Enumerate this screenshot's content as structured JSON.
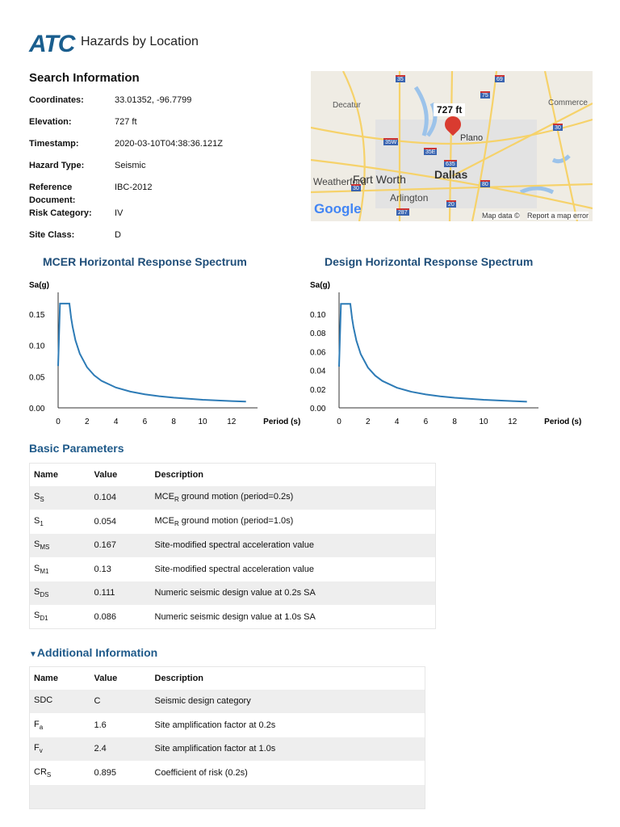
{
  "header": {
    "logo": "ATC",
    "title": "Hazards by Location"
  },
  "search": {
    "title": "Search Information",
    "fields": [
      {
        "label": "Coordinates:",
        "value": "33.01352, -96.7799"
      },
      {
        "label": "Elevation:",
        "value": "727 ft"
      },
      {
        "label": "Timestamp:",
        "value": "2020-03-10T04:38:36.121Z"
      },
      {
        "label": "Hazard Type:",
        "value": "Seismic"
      },
      {
        "label": "Reference Document:",
        "value": "IBC-2012"
      },
      {
        "label": "Risk Category:",
        "value": "IV"
      },
      {
        "label": "Site Class:",
        "value": "D"
      }
    ]
  },
  "map": {
    "marker_label": "727 ft",
    "places": [
      "Decatur",
      "Commerce",
      "Plano",
      "Fort Worth",
      "Dallas",
      "Arlington",
      "Weatherford"
    ],
    "shields": [
      "35",
      "69",
      "75",
      "35W",
      "35E",
      "635",
      "30",
      "80",
      "20",
      "287",
      "30"
    ],
    "google": "Google",
    "attribution": "Map data ©",
    "report": "Report a map error",
    "accent": "#d93b30"
  },
  "chart_data": [
    {
      "type": "line",
      "title": "MCER Horizontal Response Spectrum",
      "ylabel": "Sa(g)",
      "xlabel": "Period (s)",
      "xlim": [
        0,
        14
      ],
      "ylim": [
        0,
        0.19
      ],
      "xticks": [
        "0",
        "2",
        "4",
        "6",
        "8",
        "10",
        "12"
      ],
      "yticks": [
        "0.00",
        "0.05",
        "0.10",
        "0.15"
      ],
      "ytick_values": [
        0,
        0.05,
        0.1,
        0.15
      ],
      "x": [
        0,
        0.13,
        0.78,
        0.9,
        1,
        1.2,
        1.5,
        2,
        2.5,
        3,
        4,
        5,
        6,
        7,
        8,
        10,
        12,
        13
      ],
      "y": [
        0.067,
        0.167,
        0.167,
        0.144,
        0.13,
        0.108,
        0.0867,
        0.065,
        0.052,
        0.0433,
        0.0325,
        0.026,
        0.0217,
        0.0186,
        0.0163,
        0.013,
        0.0108,
        0.01
      ],
      "color": "#2d7bb6"
    },
    {
      "type": "line",
      "title": "Design Horizontal Response Spectrum",
      "ylabel": "Sa(g)",
      "xlabel": "Period (s)",
      "xlim": [
        0,
        14
      ],
      "ylim": [
        0,
        0.125
      ],
      "xticks": [
        "0",
        "2",
        "4",
        "6",
        "8",
        "10",
        "12"
      ],
      "yticks": [
        "0.00",
        "0.02",
        "0.04",
        "0.06",
        "0.08",
        "0.10"
      ],
      "ytick_values": [
        0,
        0.02,
        0.04,
        0.06,
        0.08,
        0.1
      ],
      "x": [
        0,
        0.13,
        0.78,
        0.9,
        1,
        1.2,
        1.5,
        2,
        2.5,
        3,
        4,
        5,
        6,
        7,
        8,
        10,
        12,
        13
      ],
      "y": [
        0.044,
        0.111,
        0.111,
        0.0956,
        0.086,
        0.0717,
        0.0573,
        0.043,
        0.0344,
        0.0287,
        0.0215,
        0.0172,
        0.0143,
        0.0123,
        0.0108,
        0.0086,
        0.0072,
        0.0066
      ],
      "color": "#2d7bb6"
    }
  ],
  "basic": {
    "title": "Basic Parameters",
    "headers": [
      "Name",
      "Value",
      "Description"
    ],
    "rows": [
      {
        "n": "S",
        "s": "S",
        "v": "0.104",
        "d": "MCE",
        "dsub": "R",
        "d2": " ground motion (period=0.2s)"
      },
      {
        "n": "S",
        "s": "1",
        "v": "0.054",
        "d": "MCE",
        "dsub": "R",
        "d2": " ground motion (period=1.0s)"
      },
      {
        "n": "S",
        "s": "MS",
        "v": "0.167",
        "d": "Site-modified spectral acceleration value"
      },
      {
        "n": "S",
        "s": "M1",
        "v": "0.13",
        "d": "Site-modified spectral acceleration value"
      },
      {
        "n": "S",
        "s": "DS",
        "v": "0.111",
        "d": "Numeric seismic design value at 0.2s SA"
      },
      {
        "n": "S",
        "s": "D1",
        "v": "0.086",
        "d": "Numeric seismic design value at 1.0s SA"
      }
    ]
  },
  "additional": {
    "title": "Additional Information",
    "headers": [
      "Name",
      "Value",
      "Description"
    ],
    "rows": [
      {
        "n": "SDC",
        "s": "",
        "v": "C",
        "d": "Seismic design category"
      },
      {
        "n": "F",
        "s": "a",
        "v": "1.6",
        "d": "Site amplification factor at 0.2s"
      },
      {
        "n": "F",
        "s": "v",
        "v": "2.4",
        "d": "Site amplification factor at 1.0s"
      },
      {
        "n": "CR",
        "s": "S",
        "v": "0.895",
        "d": "Coefficient of risk (0.2s)"
      }
    ]
  }
}
